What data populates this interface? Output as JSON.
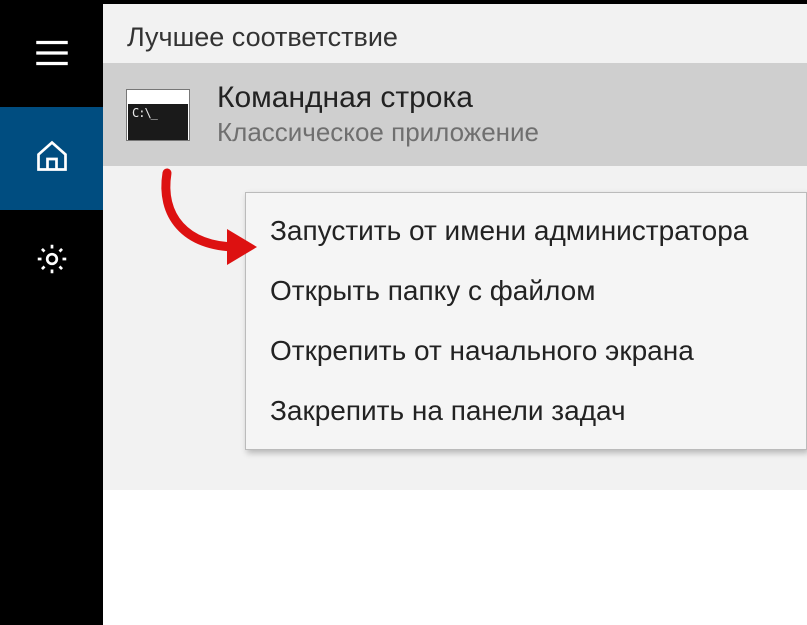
{
  "header": {
    "title": "Лучшее соответствие"
  },
  "result": {
    "title": "Командная строка",
    "subtitle": "Классическое приложение",
    "icon_name": "command-prompt-icon"
  },
  "context_menu": {
    "items": [
      {
        "label": "Запустить от имени администратора"
      },
      {
        "label": "Открыть папку с файлом"
      },
      {
        "label": "Открепить от начального экрана"
      },
      {
        "label": "Закрепить на панели задач"
      }
    ]
  },
  "sidebar": {
    "items": [
      {
        "name": "hamburger"
      },
      {
        "name": "home",
        "active": true
      },
      {
        "name": "settings"
      }
    ]
  }
}
